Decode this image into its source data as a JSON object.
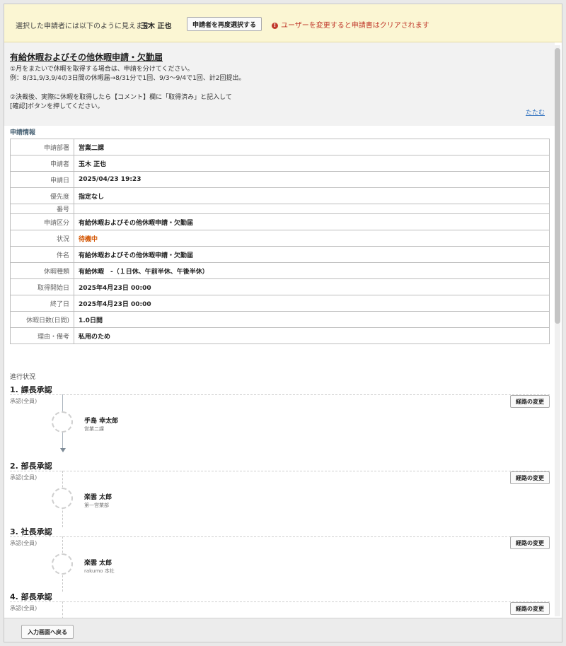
{
  "banner": {
    "label": "選択した申請者には以下のように見えます：",
    "applicant_name": "玉木 正也",
    "reselect_button": "申請者を再度選択する",
    "warning": "ユーザーを変更すると申請書はクリアされます",
    "warning_icon": "exclamation-circle-icon"
  },
  "notice": {
    "title": "有給休暇およびその他休暇申請・欠勤届",
    "lines": [
      "①月をまたいで休暇を取得する場合は、申請を分けてください。",
      "例：8/31,9/3,9/4の3日間の休暇届→8/31分で1回、9/3〜9/4で1回、計2回提出。",
      "②決裁後、実際に休暇を取得したら【コメント】欄に「取得済み」と記入して",
      "[確認]ボタンを押してください。"
    ],
    "fold_link": "たたむ"
  },
  "info": {
    "section_label": "申請情報",
    "rows": [
      {
        "key": "申請部署",
        "value": "営業二課"
      },
      {
        "key": "申請者",
        "value": "玉木 正也"
      },
      {
        "key": "申請日",
        "value": "2025/04/23 19:23"
      },
      {
        "key": "優先度",
        "value": "指定なし"
      },
      {
        "key": "番号",
        "value": ""
      },
      {
        "key": "申請区分",
        "value": "有給休暇およびその他休暇申請・欠勤届"
      },
      {
        "key": "状況",
        "value": "待機中"
      },
      {
        "key": "件名",
        "value": "有給休暇およびその他休暇申請・欠勤届"
      },
      {
        "key": "休暇種類",
        "value": "有給休暇　-（１日休、午前半休、午後半休）"
      },
      {
        "key": "取得開始日",
        "value": "2025年4月23日 00:00"
      },
      {
        "key": "終了日",
        "value": "2025年4月23日 00:00"
      },
      {
        "key": "休暇日数(日間)",
        "value": "1.0日間"
      },
      {
        "key": "理由・備考",
        "value": "私用のため"
      }
    ],
    "status_color": "#d35400"
  },
  "progress": {
    "section_label": "進行状況",
    "route_button": "経路の変更",
    "steps": [
      {
        "title": "1. 課長承認",
        "sub": "承認(全員)",
        "person": "手島 幸太郎",
        "dept": "営業二課"
      },
      {
        "title": "2. 部長承認",
        "sub": "承認(全員)",
        "person": "楽雲 太郎",
        "dept": "第一営業部"
      },
      {
        "title": "3. 社長承認",
        "sub": "承認(全員)",
        "person": "楽雲 太郎",
        "dept": "rakumo 本社"
      },
      {
        "title": "4. 部長承認",
        "sub": "承認(全員)",
        "person": "",
        "dept": ""
      }
    ]
  },
  "footer": {
    "back_button": "入力画面へ戻る"
  }
}
